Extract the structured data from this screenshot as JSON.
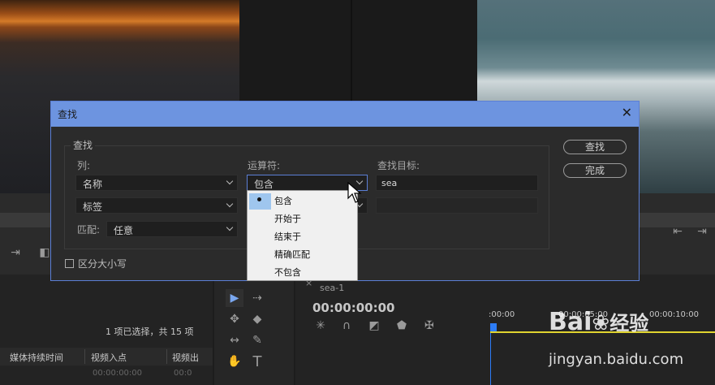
{
  "dialog": {
    "title": "查找",
    "group_label": "查找",
    "column_label": "列:",
    "operator_label": "运算符:",
    "target_label": "查找目标:",
    "column1_value": "名称",
    "column2_value": "标签",
    "operator1_value": "包含",
    "target1_value": "sea",
    "match_label": "匹配:",
    "match_value": "任意",
    "case_label": "区分大小写",
    "find_button": "查找",
    "done_button": "完成"
  },
  "operator_menu": {
    "items": [
      "包含",
      "开始于",
      "结束于",
      "精确匹配",
      "不包含"
    ],
    "selected_index": 0
  },
  "project": {
    "status": "1 项已选择，共 15 项",
    "col_media_duration": "媒体持续时间",
    "col_video_in": "视频入点",
    "col_video_out": "视频出",
    "row1_in": "00:00:00:00",
    "row1_out": "00:0"
  },
  "timeline": {
    "tab": "sea-1",
    "timecode": "00:00:00:00",
    "ruler_labels": [
      ":00:00",
      "00:00:05:00",
      "00:00:10:00"
    ]
  },
  "watermark": {
    "text1": "Bai",
    "text2": "经验",
    "url": "jingyan.baidu.com"
  },
  "colors": {
    "accent": "#6d94e0",
    "playhead": "#2d7cf6",
    "timeline_bar": "#e0d430"
  }
}
